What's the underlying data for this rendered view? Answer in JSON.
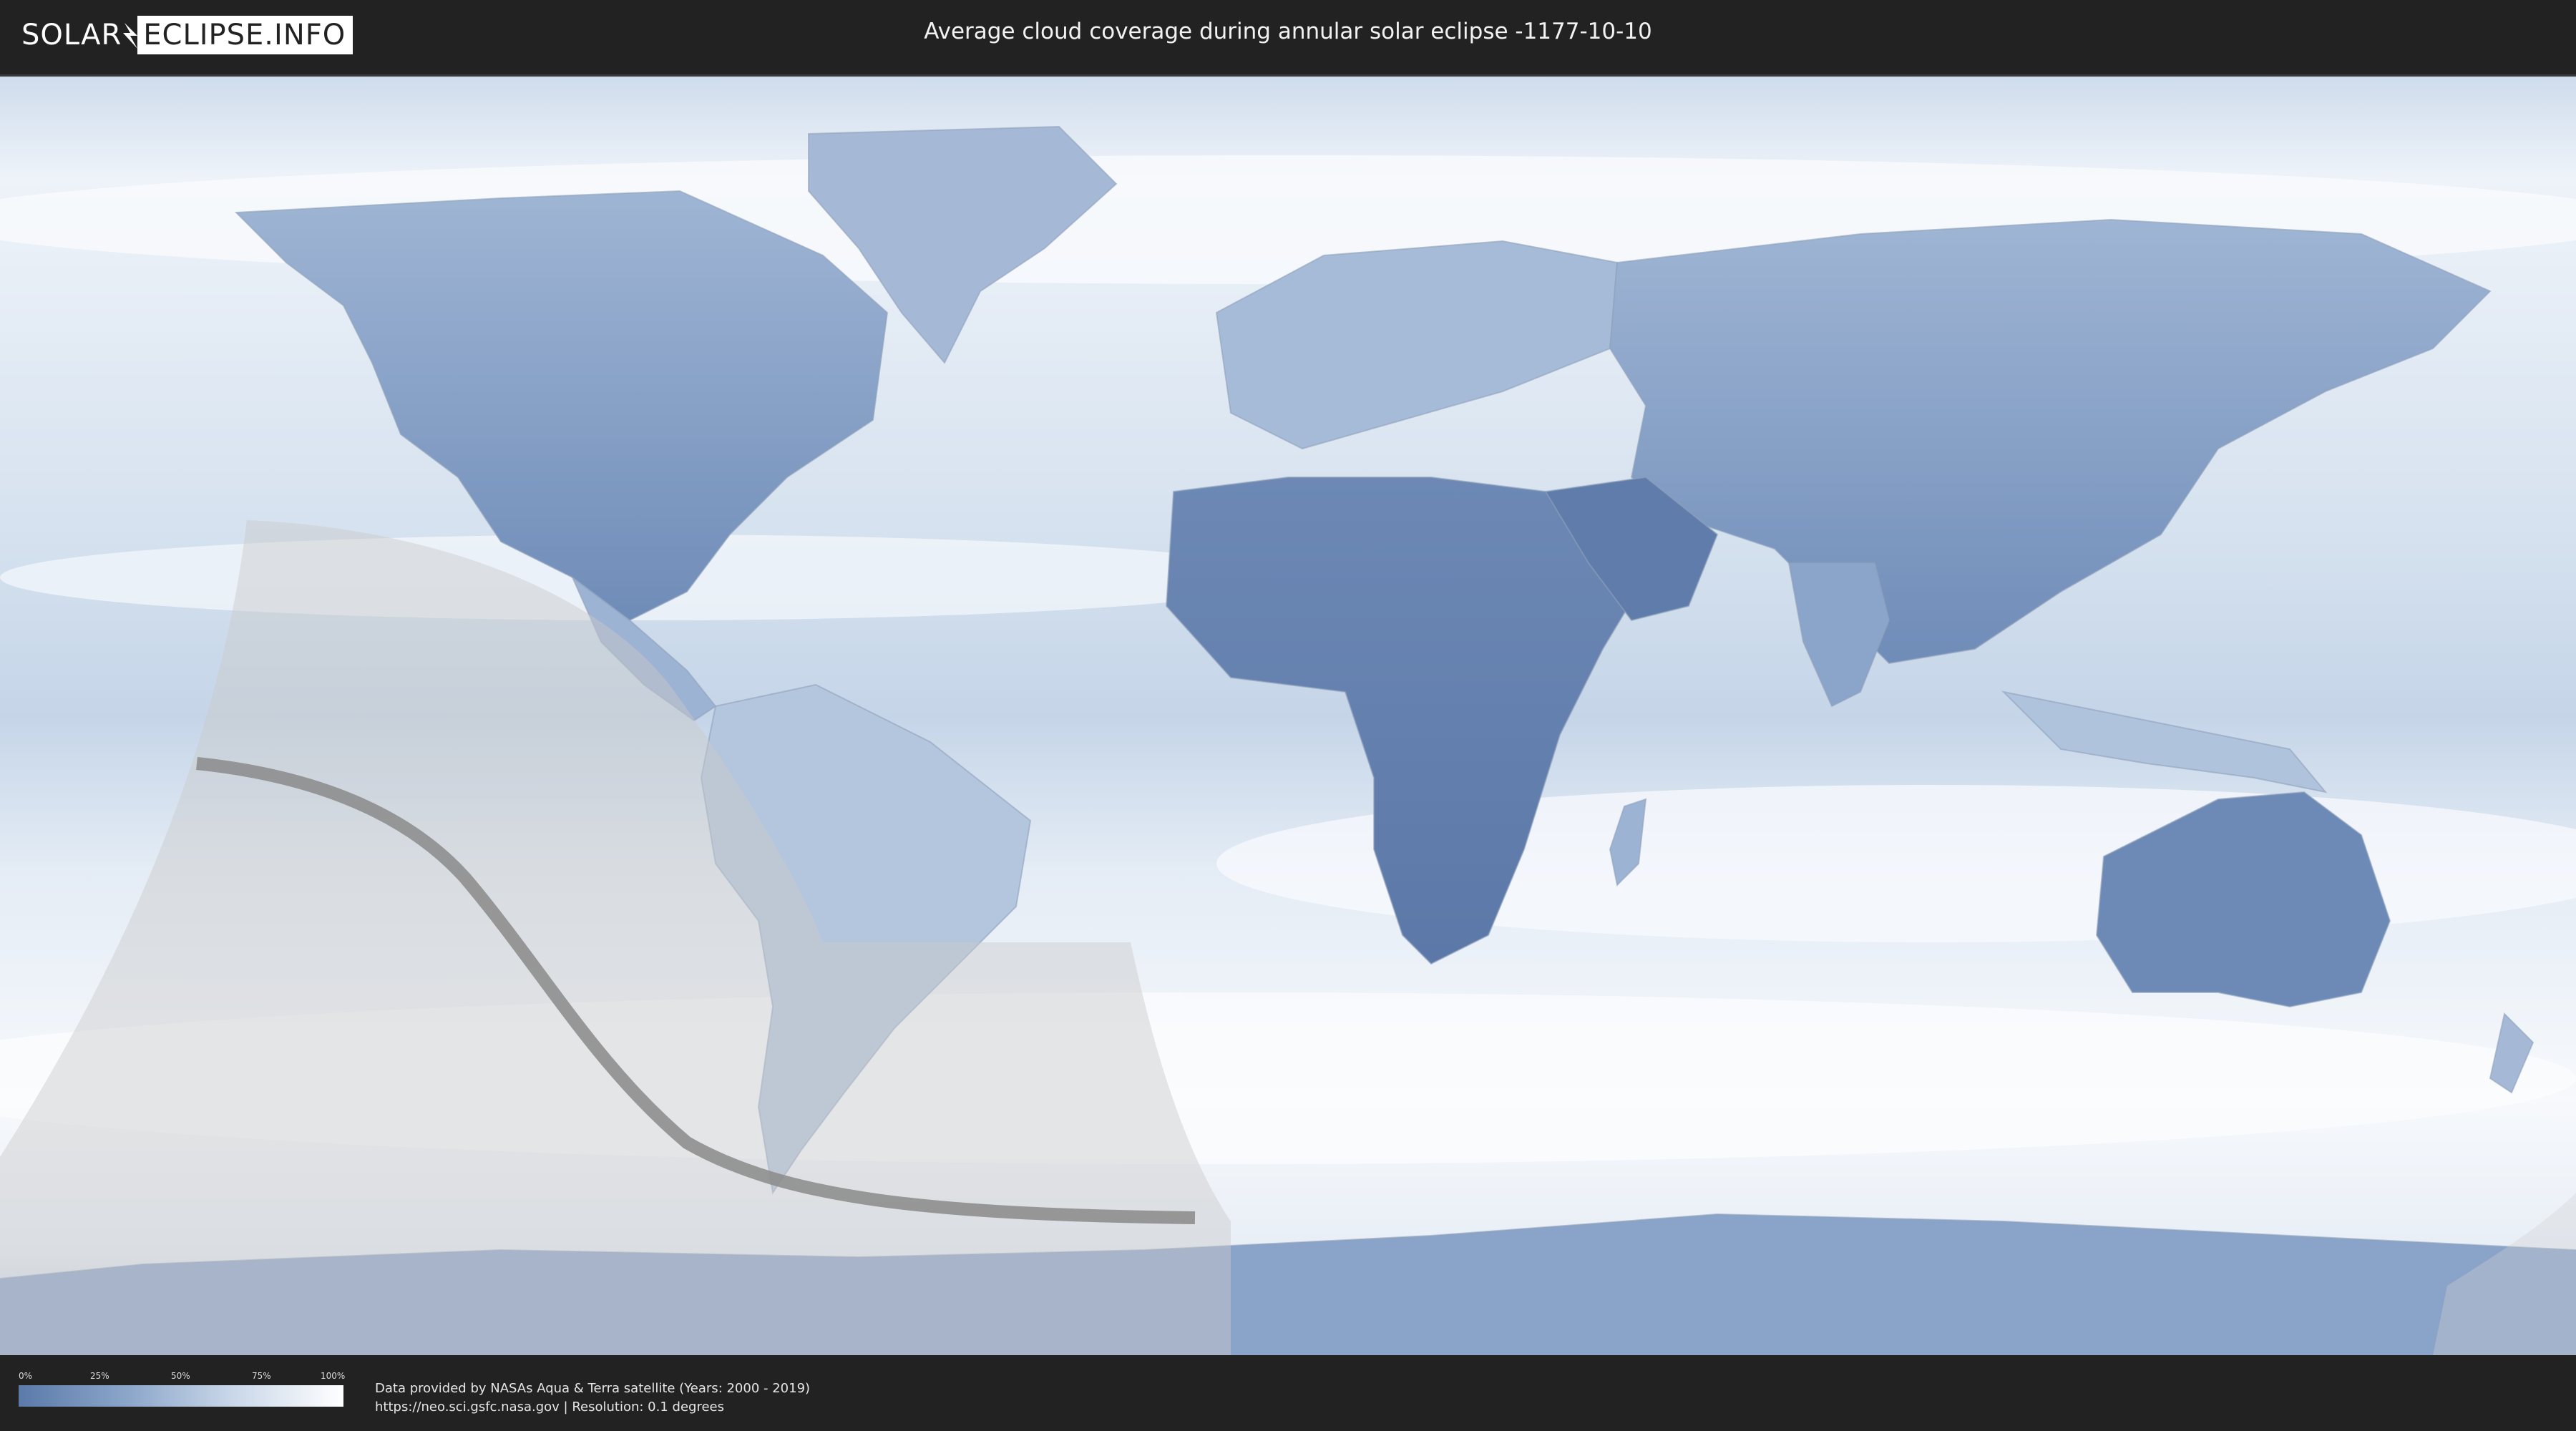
{
  "header": {
    "logo_left": "SOLAR",
    "logo_right": "ECLIPSE.INFO",
    "title": "Average cloud coverage during annular solar eclipse -1177-10-10"
  },
  "map": {
    "ocean_color": "#dde7f2",
    "cloud_color": "#f6f9fc",
    "land_clear_color": "#5b7aaa",
    "land_mid_color": "#9cb3d3",
    "eclipse_zone_color": "#c8c8c8",
    "central_line_color": "#8a8a8a"
  },
  "footer": {
    "legend": {
      "ticks": [
        "0%",
        "25%",
        "50%",
        "75%",
        "100%"
      ],
      "gradient_start": "#5b7aaa",
      "gradient_end": "#ffffff"
    },
    "credit_line1": "Data provided by NASAs Aqua & Terra satellite (Years: 2000 - 2019)",
    "credit_line2": "https://neo.sci.gsfc.nasa.gov | Resolution: 0.1 degrees"
  }
}
